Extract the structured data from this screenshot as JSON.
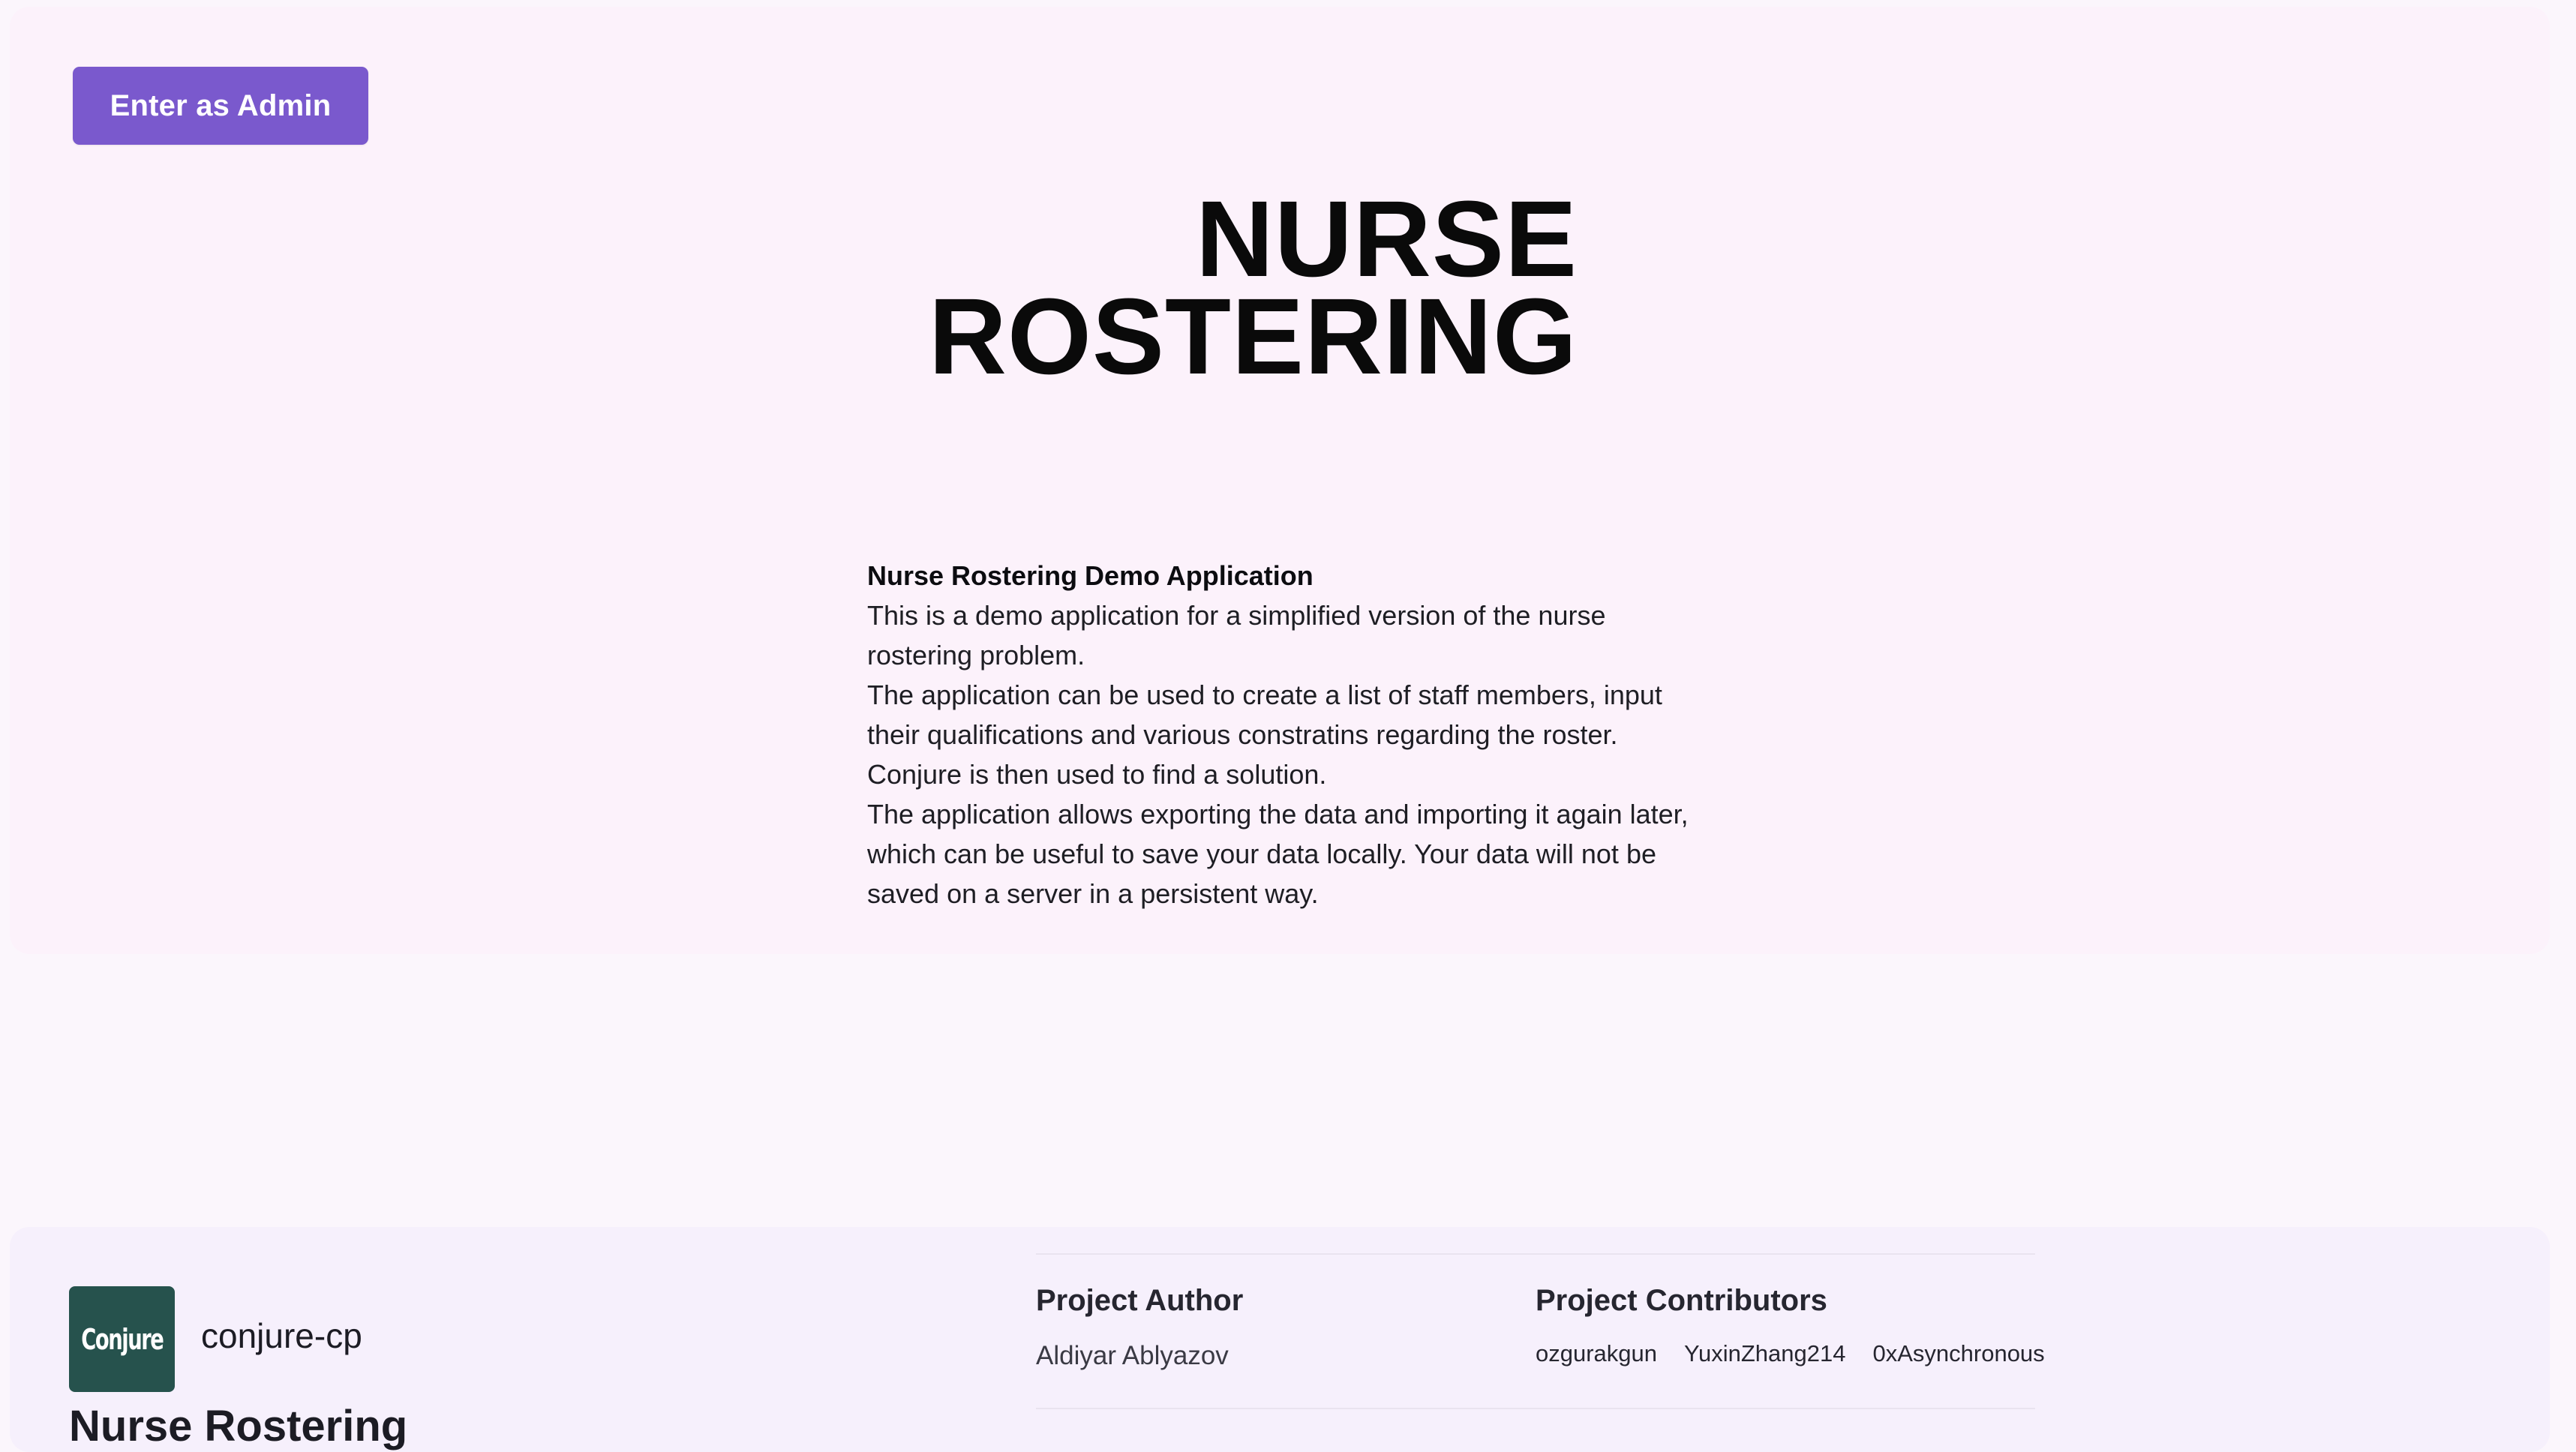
{
  "header": {
    "admin_button_label": "Enter as Admin"
  },
  "hero": {
    "title_line1": "NURSE",
    "title_line2": "ROSTERING"
  },
  "description": {
    "heading": "Nurse Rostering Demo Application",
    "paragraphs": [
      "This is a demo application for a simplified version of the nurse rostering problem.",
      "The application can be used to create a list of staff members, input their qualifications and various constratins regarding the roster.",
      "Conjure is then used to find a solution.",
      "The application allows exporting the data and importing it again later, which can be useful to save your data locally. Your data will not be saved on a server in a persistent way."
    ]
  },
  "footer": {
    "logo_text": "Conjure",
    "brand_name": "conjure-cp",
    "app_name": "Nurse Rostering",
    "author_title": "Project Author",
    "author_name": "Aldiyar Ablyazov",
    "contributors_title": "Project Contributors",
    "contributors": [
      "ozgurakgun",
      "YuxinZhang214",
      "0xAsynchronous"
    ]
  },
  "colors": {
    "accent": "#7a59cd",
    "logo_bg": "#26524d",
    "page_bg": "#fbf6fc"
  }
}
